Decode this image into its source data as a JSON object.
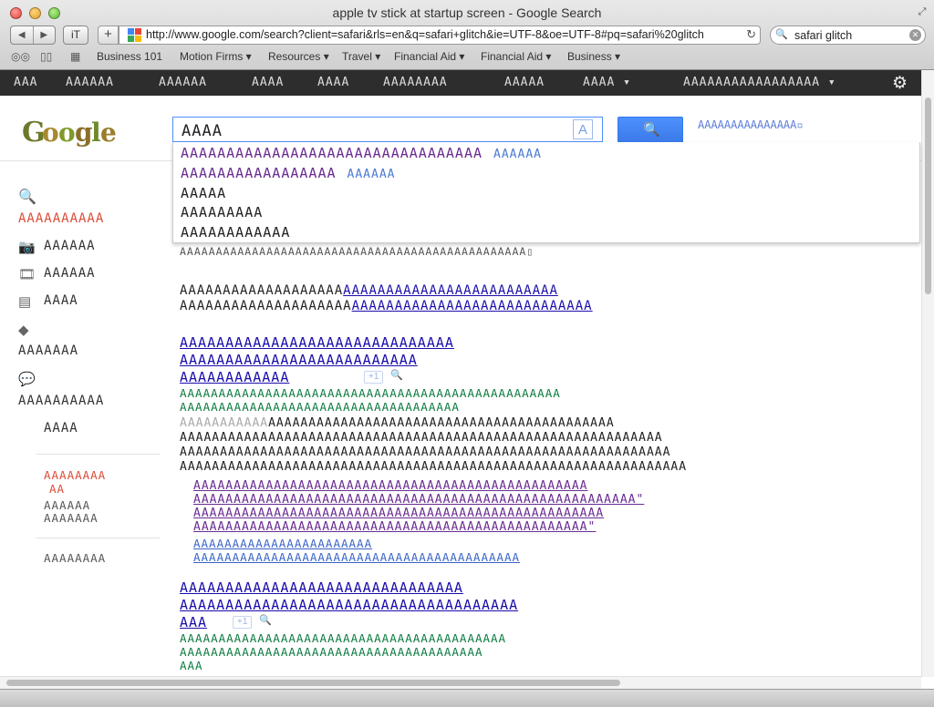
{
  "window": {
    "title": "apple tv stick at startup screen - Google Search"
  },
  "toolbar": {
    "back": "◀",
    "forward": "▶",
    "it_button": "iT",
    "add_button": "+",
    "url": "http://www.google.com/search?client=safari&rls=en&q=safari+glitch&ie=UTF-8&oe=UTF-8#pq=safari%20glitch",
    "reload": "↻",
    "search_value": "safari glitch",
    "clear": "✕"
  },
  "bookmarks": {
    "items": [
      "Business 101",
      "Motion Firms ▾",
      "Resources ▾",
      "Travel ▾",
      "Financial Aid ▾",
      "Financial Aid ▾",
      "Business ▾"
    ]
  },
  "gbar": {
    "items": [
      "AAA",
      "AAAAAA",
      "AAAAAA",
      "AAAA",
      "AAAA",
      "AAAAAAAA",
      "AAAAA",
      "AAAA ▾",
      "AAAAAAAAAAAAAAAAA ▾"
    ]
  },
  "search": {
    "query": "AAAA",
    "keyboard_icon": "A",
    "button_icon": "🔍",
    "advanced_link": "AAAAAAAAAAAAAAA▫"
  },
  "suggestions": [
    {
      "text": "AAAAAAAAAAAAAAAAAAAAAAAAAAAAAAAAA",
      "tag": "AAAAAA",
      "visited": true
    },
    {
      "text": "AAAAAAAAAAAAAAAAA",
      "tag": "AAAAAA",
      "visited": true
    },
    {
      "text": "AAAAA",
      "tag": "",
      "visited": false
    },
    {
      "text": "AAAAAAAAA",
      "tag": "",
      "visited": false
    },
    {
      "text": "AAAAAAAAAAAA",
      "tag": "",
      "visited": false
    }
  ],
  "left_nav": {
    "everything": "AAAAAAAAAA",
    "images": "AAAAAA",
    "videos": "AAAAAA",
    "news": "AAAA",
    "shopping": "AAAAAAA",
    "discussions": "AAAAAAAAAA",
    "more": "AAAA",
    "tools_red": "AAAAAAAA",
    "tools_red_2": "AA",
    "tools_1": "AAAAAA",
    "tools_2": "AAAAAAA",
    "bottom": "AAAAAAAA"
  },
  "results": {
    "stats": "AAAAAAAAAAAAAAAAAAAAAAAAAAAAAAAAAAAAAAAAAAAAAAAA▯",
    "notice_1a": "AAAAAAAAAAAAAAAAAAA",
    "notice_1b": "AAAAAAAAAAAAAAAAAAAAAAAAA",
    "notice_2a": "AAAAAAAAAAAAAAAAAAAA",
    "notice_2b": "AAAAAAAAAAAAAAAAAAAAAAAAAAAA",
    "r1_title1": "AAAAAAAAAAAAAAAAAAAAAAAAAAAAAA",
    "r1_title2": "AAAAAAAAAAAAAAAAAAAAAAAAAA",
    "r1_title3": "AAAAAAAAAAAA",
    "r1_plus": "+1",
    "r1_url1": "AAAAAAAAAAAAAAAAAAAAAAAAAAAAAAAAAAAAAAAAAAAAAAAAA",
    "r1_url2": "AAAAAAAAAAAAAAAAAAAAAAAAAAAAAAAAAAAA",
    "r1_snip_grey": "AAAAAAAAAAA",
    "r1_snip1": "AAAAAAAAAAAAAAAAAAAAAAAAAAAAAAAAAAAAAAAAAAA",
    "r1_snip2": "AAAAAAAAAAAAAAAAAAAAAAAAAAAAAAAAAAAAAAAAAAAAAAAAAAAAAAAAAAAA",
    "r1_snip3": "AAAAAAAAAAAAAAAAAAAAAAAAAAAAAAAAAAAAAAAAAAAAAAAAAAAAAAAAAAAAA",
    "r1_snip4": "AAAAAAAAAAAAAAAAAAAAAAAAAAAAAAAAAAAAAAAAAAAAAAAAAAAAAAAAAAAAAAA",
    "r1_sub1": "AAAAAAAAAAAAAAAAAAAAAAAAAAAAAAAAAAAAAAAAAAAAAAAAA",
    "r1_sub2": "AAAAAAAAAAAAAAAAAAAAAAAAAAAAAAAAAAAAAAAAAAAAAAAAAAAAAAA\"",
    "r1_sub3": "AAAAAAAAAAAAAAAAAAAAAAAAAAAAAAAAAAAAAAAAAAAAAAAAAAA",
    "r1_sub4": "AAAAAAAAAAAAAAAAAAAAAAAAAAAAAAAAAAAAAAAAAAAAAAAAA\"",
    "r1_more1": "AAAAAAAAAAAAAAAAAAAAAAA",
    "r1_more2": "AAAAAAAAAAAAAAAAAAAAAAAAAAAAAAAAAAAAAAAAAA",
    "r2_title1": "AAAAAAAAAAAAAAAAAAAAAAAAAAAAAAA",
    "r2_title2": "AAAAAAAAAAAAAAAAAAAAAAAAAAAAAAAAAAAAA",
    "r2_title3": "AAA",
    "r2_plus": "+1",
    "r2_url1": "AAAAAAAAAAAAAAAAAAAAAAAAAAAAAAAAAAAAAAAAAA",
    "r2_url2": "AAAAAAAAAAAAAAAAAAAAAAAAAAAAAAAAAAAAAAA",
    "r2_url3": "AAA"
  },
  "colors": {
    "gbar_bg": "#2d2d2d",
    "link": "#1a0dab",
    "visited": "#6a2c91",
    "url_green": "#0a7a3e",
    "accent_red": "#dd4b39",
    "search_blue": "#4d90fe"
  }
}
